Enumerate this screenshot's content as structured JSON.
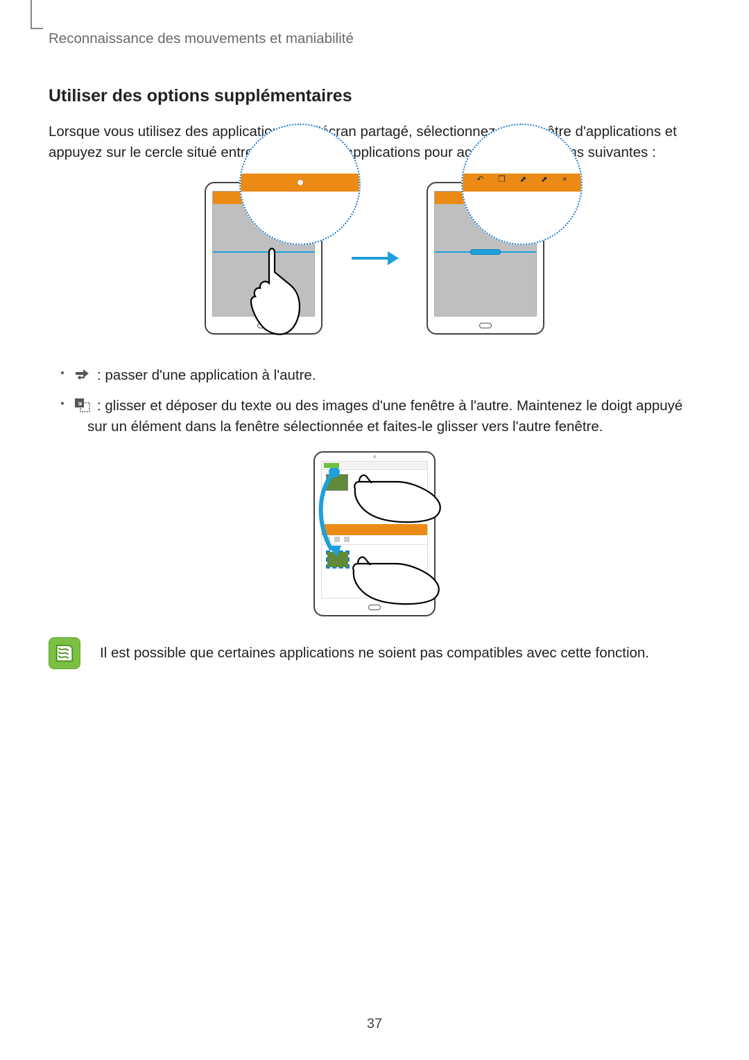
{
  "header": {
    "chapter_title": "Reconnaissance des mouvements et maniabilité"
  },
  "section": {
    "title": "Utiliser des options supplémentaires",
    "intro": "Lorsque vous utilisez des applications sur l'écran partagé, sélectionnez une fenêtre d'applications et appuyez sur le cercle situé entre les fenêtres d'applications pour accéder aux options suivantes :"
  },
  "bullets": [
    {
      "icon": "swap-apps-icon",
      "text": " : passer d'une application à l'autre."
    },
    {
      "icon": "drag-content-icon",
      "text": " : glisser et déposer du texte ou des images d'une fenêtre à l'autre. Maintenez le doigt appuyé sur un élément dans la fenêtre sélectionnée et faites-le glisser vers l'autre fenêtre."
    }
  ],
  "zoom2_icons": [
    "↶",
    "❐",
    "⬈",
    "⬈",
    "×"
  ],
  "note": {
    "text": "Il est possible que certaines applications ne soient pas compatibles avec cette fonction."
  },
  "page_number": "37"
}
